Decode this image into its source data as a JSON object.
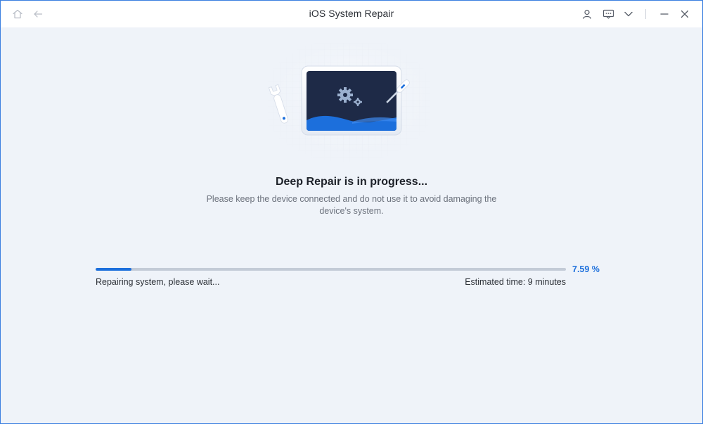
{
  "window": {
    "title": "iOS System Repair"
  },
  "toolbar": {
    "left_icons": [
      "home-icon",
      "back-arrow-icon"
    ],
    "right_icons": [
      "user-icon",
      "feedback-icon",
      "dropdown-chevron-icon",
      "minimize-icon",
      "close-icon"
    ]
  },
  "main": {
    "heading": "Deep Repair is in progress...",
    "subtext": "Please keep the device connected and do not use it to avoid damaging the device's system."
  },
  "progress": {
    "value_percent": 7.59,
    "percent_label": "7.59 %",
    "status_text": "Repairing system, please wait...",
    "estimate_text": "Estimated time: 9 minutes"
  },
  "colors": {
    "accent": "#1c6fdc",
    "background": "#eff3f9",
    "track": "#c3cbd7",
    "screen_dark": "#1e2a47"
  }
}
